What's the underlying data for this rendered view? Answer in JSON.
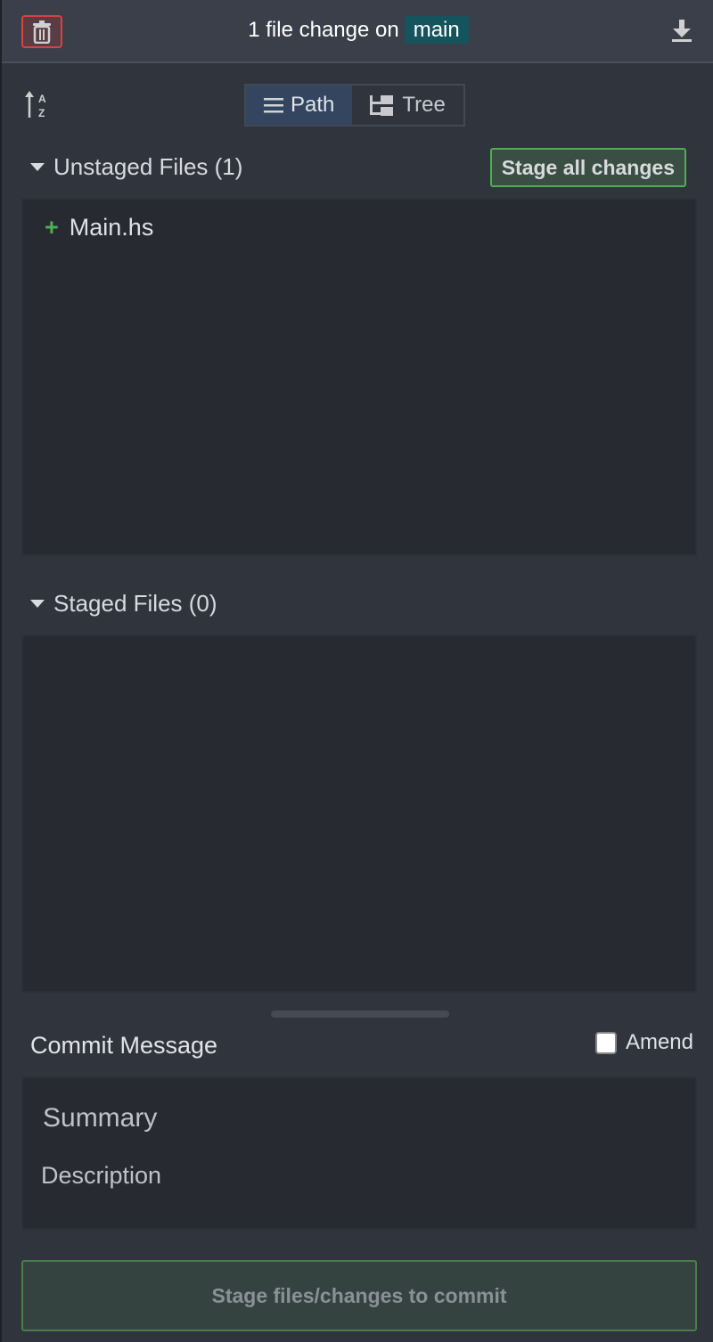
{
  "header": {
    "title_prefix": "1 file change on",
    "branch": "main",
    "discard_icon": "trash-icon",
    "download_icon": "download-icon"
  },
  "toolbar": {
    "sort_icon": "sort-alpha-icon",
    "view_modes": [
      {
        "label": "Path",
        "active": true,
        "icon": "list-icon"
      },
      {
        "label": "Tree",
        "active": false,
        "icon": "tree-icon"
      }
    ]
  },
  "unstaged": {
    "title": "Unstaged Files (1)",
    "stage_all_label": "Stage all changes",
    "files": [
      {
        "name": "Main.hs",
        "status": "added"
      }
    ]
  },
  "staged": {
    "title": "Staged Files (0)",
    "files": []
  },
  "commit": {
    "label": "Commit Message",
    "amend_label": "Amend",
    "amend_checked": false,
    "summary_placeholder": "Summary",
    "description_placeholder": "Description",
    "button_label": "Stage files/changes to commit"
  },
  "colors": {
    "accent_green": "#4caf50",
    "danger": "#d9423f",
    "branch_bg": "#15545d"
  }
}
